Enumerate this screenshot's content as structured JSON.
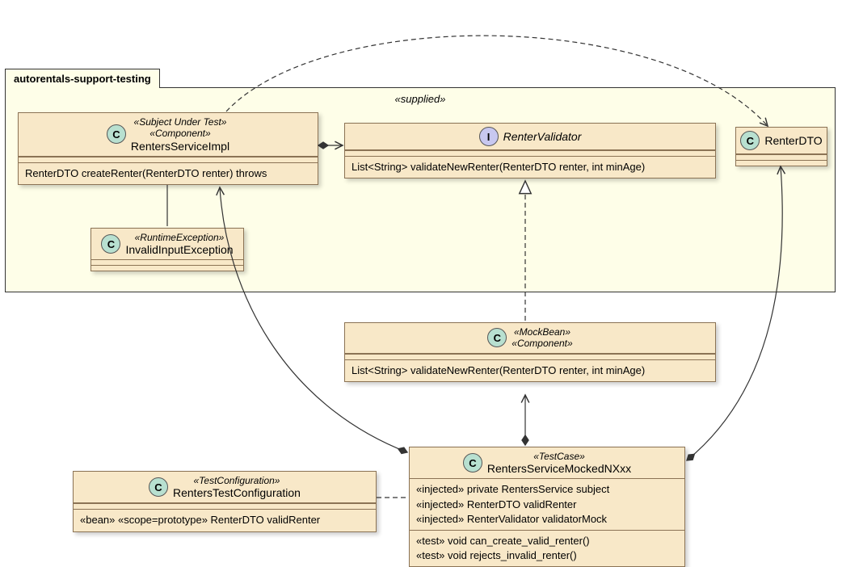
{
  "package": {
    "name": "autorentals-support-testing",
    "label": "«supplied»"
  },
  "classes": {
    "impl": {
      "stereo1": "«Subject Under Test»",
      "stereo2": "«Component»",
      "name": "RentersServiceImpl",
      "op": "RenterDTO createRenter(RenterDTO renter) throws"
    },
    "validator": {
      "name": "RenterValidator",
      "op": "List<String> validateNewRenter(RenterDTO renter, int minAge)"
    },
    "dto": {
      "name": "RenterDTO"
    },
    "exception": {
      "stereo": "«RuntimeException»",
      "name": "InvalidInputException"
    },
    "mock": {
      "stereo1": "«MockBean»",
      "stereo2": "«Component»",
      "op": "List<String> validateNewRenter(RenterDTO renter, int minAge)"
    },
    "testcase": {
      "stereo": "«TestCase»",
      "name": "RentersServiceMockedNXxx",
      "attr1": "«injected» private RentersService subject",
      "attr2": "«injected» RenterDTO validRenter",
      "attr3": "«injected» RenterValidator validatorMock",
      "op1": "«test» void can_create_valid_renter()",
      "op2": "«test» void rejects_invalid_renter()"
    },
    "testconfig": {
      "stereo": "«TestConfiguration»",
      "name": "RentersTestConfiguration",
      "op": "«bean» «scope=prototype» RenterDTO validRenter"
    }
  }
}
